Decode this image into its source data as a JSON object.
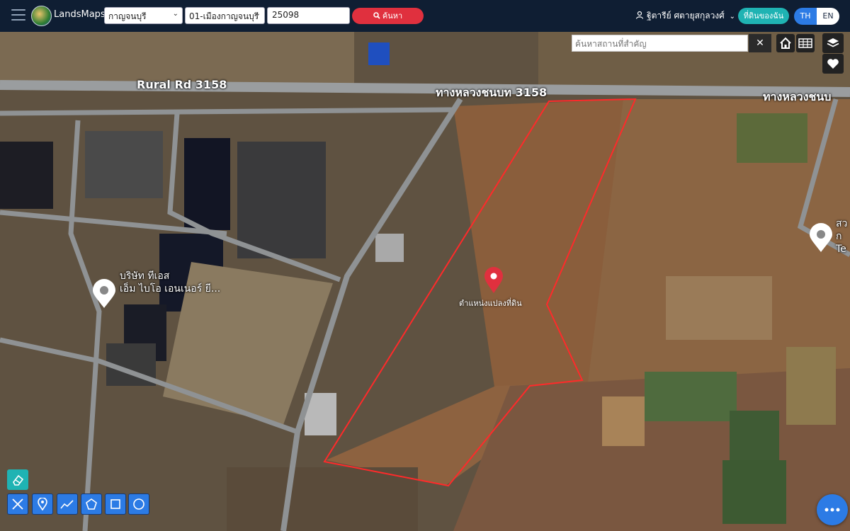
{
  "app": {
    "brand": "LandsMaps"
  },
  "search": {
    "province": "กาญจนบุรี",
    "district": "01-เมืองกาญจนบุรี",
    "parcel_number": "25098",
    "search_label": "ค้นหา"
  },
  "user": {
    "name": "ฐิตารีย์ ศตายุสกุลวงศ์",
    "my_land_label": "ที่ดินของฉัน",
    "lang_th": "TH",
    "lang_en": "EN"
  },
  "map": {
    "place_search_placeholder": "ค้นหาสถานที่สำคัญ",
    "clear_label": "✕",
    "road_label_en": "Rural Rd 3158",
    "road_label_th": "ทางหลวงชนบท 3158",
    "road_label_th_right": "ทางหลวงชนบ",
    "poi_company_line1": "บริษัท ทีเอส",
    "poi_company_line2": "เอ็ม ไบโอ เอนเนอร์ ยี...",
    "poi_right_line1": "สว",
    "poi_right_line2": "ก",
    "poi_right_line3": "Te",
    "parcel_pin_label": "ตำแหน่งแปลงที่ดิน",
    "parcel_outline_color": "#ff2a2a",
    "pin_color": "#e0303e"
  },
  "tools": {
    "items": [
      "eraser-icon",
      "measure-icon",
      "marker-icon",
      "polyline-icon",
      "polygon-icon",
      "rectangle-icon",
      "circle-icon"
    ]
  },
  "controls": {
    "items": [
      "home-icon",
      "grid-icon",
      "layers-icon",
      "favorite-icon",
      "chat-icon"
    ]
  },
  "colors": {
    "topbar": "#0f1e33",
    "search_button": "#e0303e",
    "my_land_button": "#1fb3b3",
    "lang_active": "#2c7be5",
    "tool_button": "#2c7be5"
  }
}
